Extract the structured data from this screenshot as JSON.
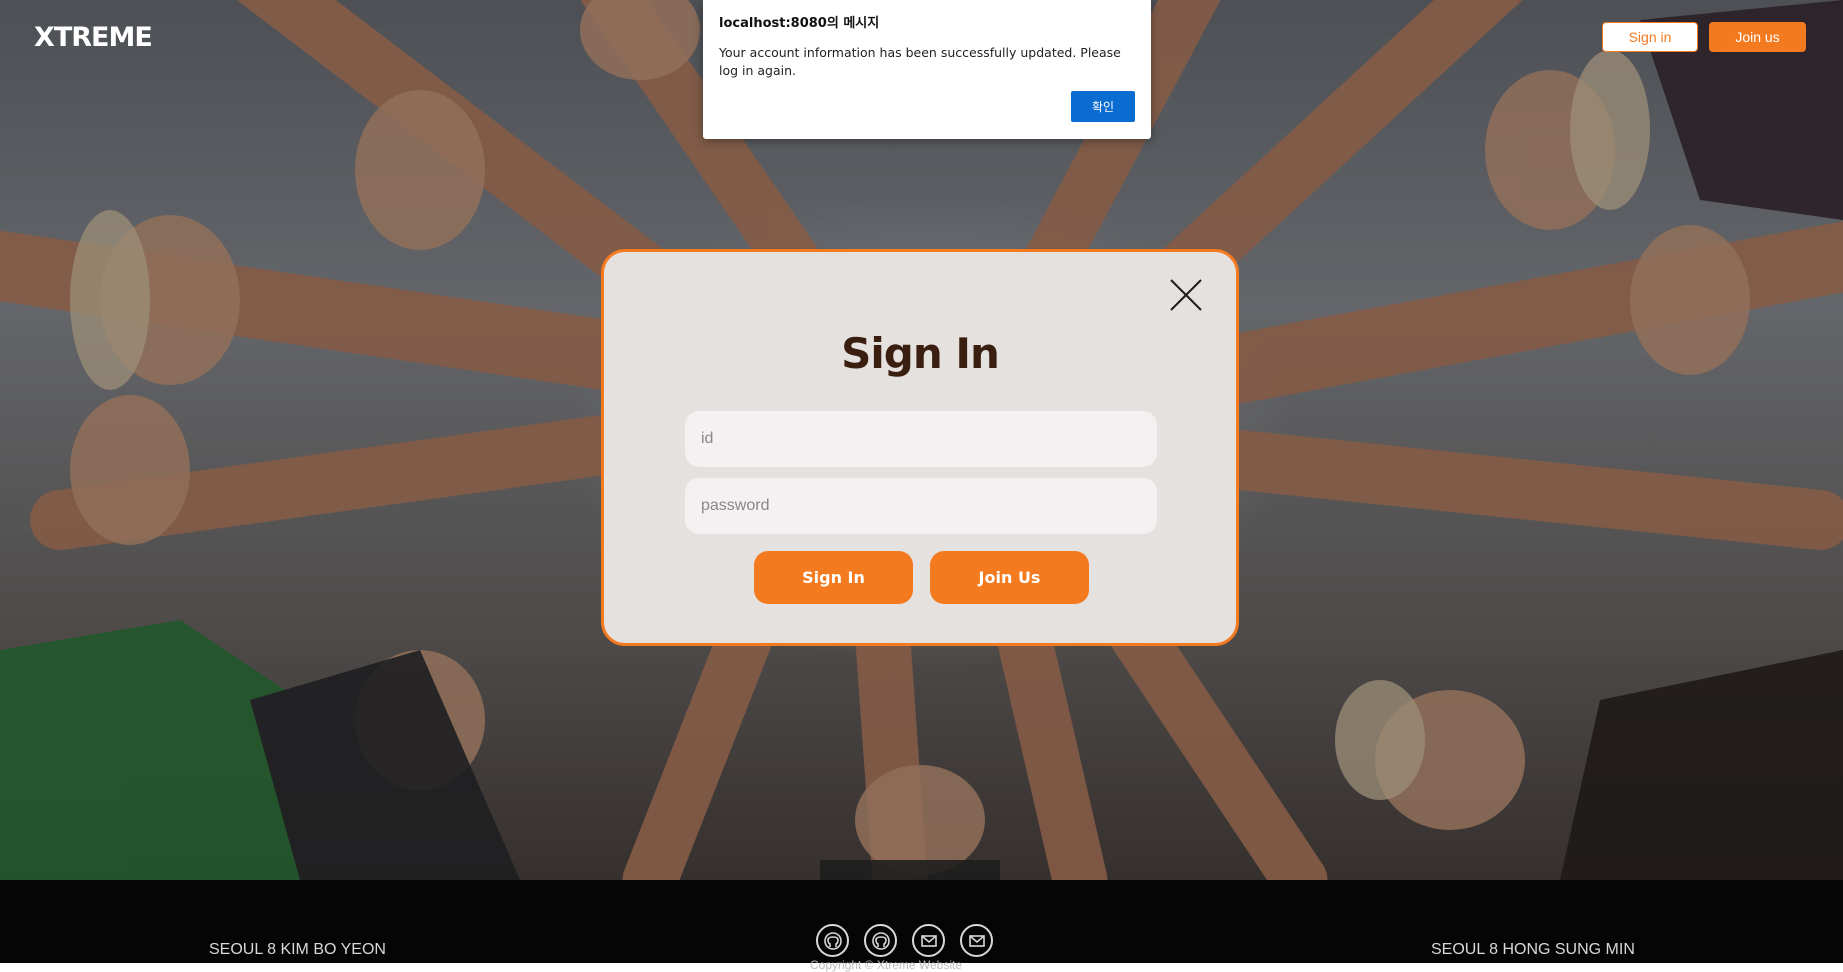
{
  "header": {
    "brand": "XTREME",
    "signin_label": "Sign in",
    "join_label": "Join us"
  },
  "alert": {
    "title": "localhost:8080의 메시지",
    "message": "Your account information has been successfully updated. Please log in again.",
    "ok_label": "확인"
  },
  "modal": {
    "title": "Sign In",
    "id_placeholder": "id",
    "password_placeholder": "password",
    "signin_label": "Sign In",
    "join_label": "Join Us",
    "close_icon": "close-icon"
  },
  "footer": {
    "left_text": "SEOUL 8 KIM BO YEON",
    "right_text": "SEOUL 8 HONG SUNG MIN",
    "copyright": "Copyright © Xtreme Website",
    "icons": [
      "github-icon",
      "github-icon",
      "mail-icon",
      "mail-icon"
    ]
  },
  "colors": {
    "accent": "#f47a20",
    "modal_bg": "#e5e1df",
    "title_text": "#3a1f10",
    "alert_button": "#0a6bd1",
    "footer_bg": "#050505"
  }
}
